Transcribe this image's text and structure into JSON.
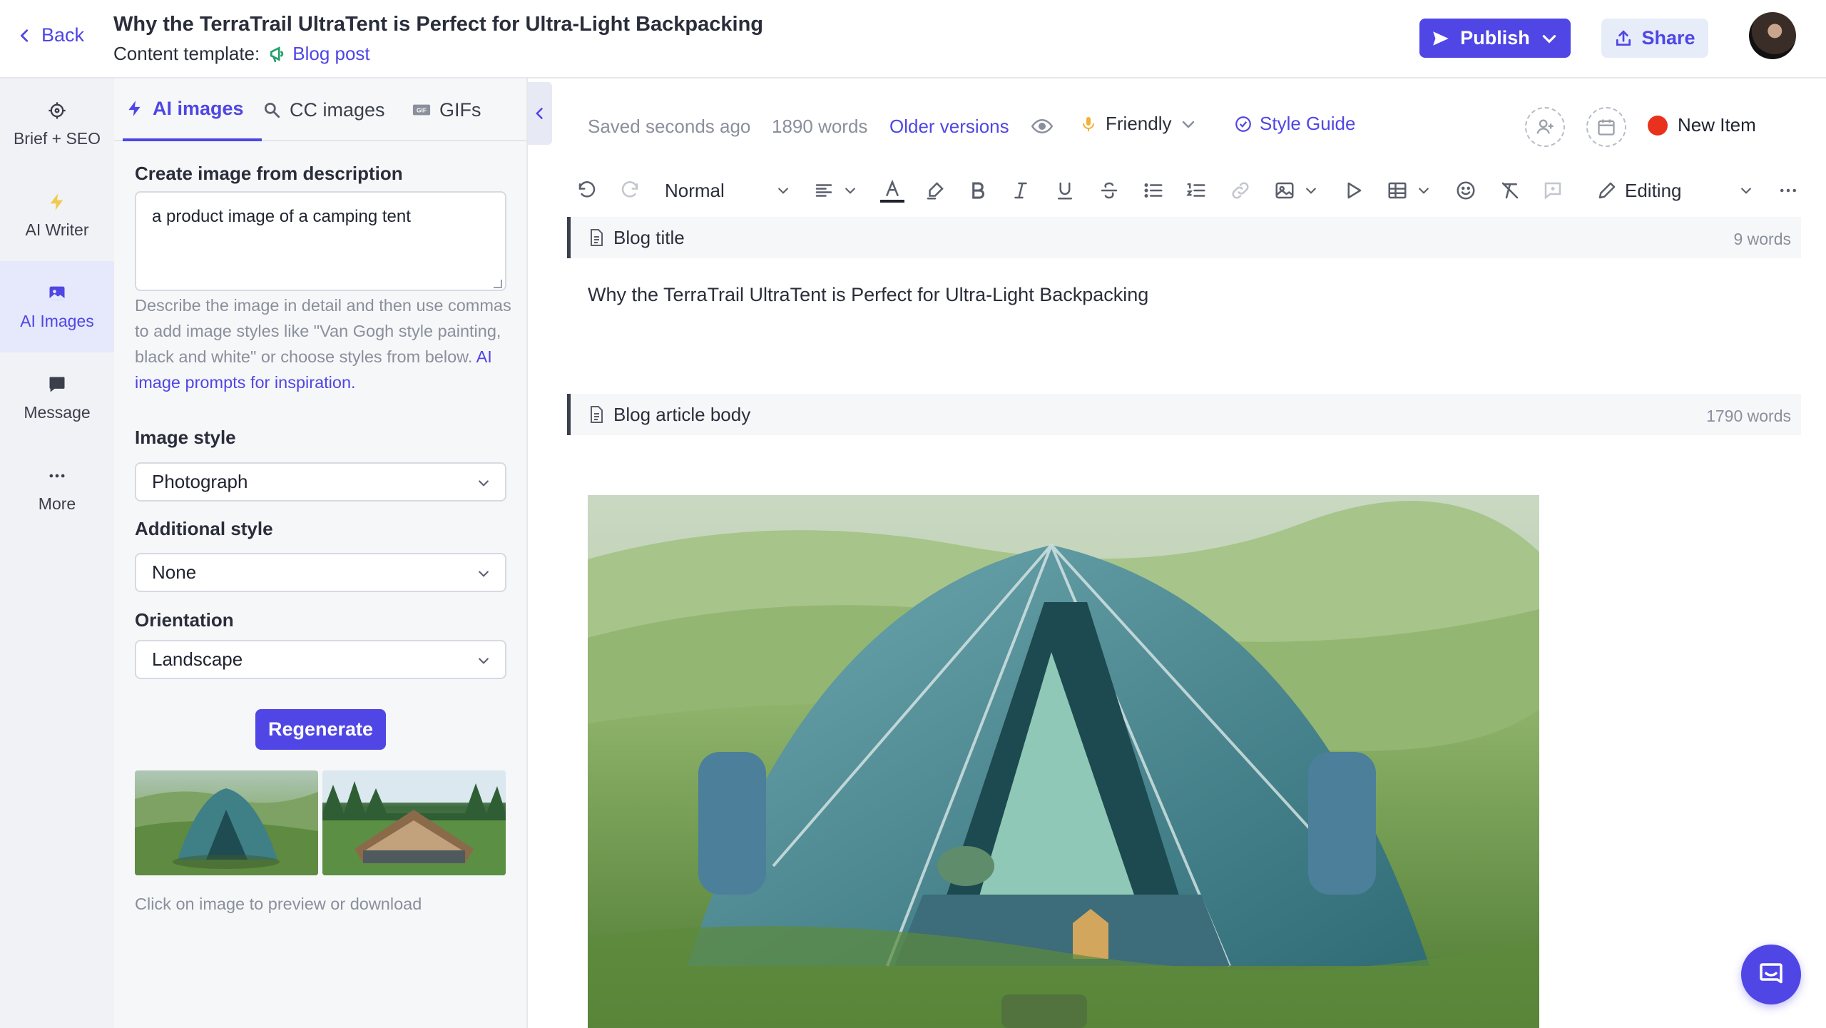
{
  "header": {
    "back_label": "Back",
    "title": "Why the TerraTrail UltraTent is Perfect for Ultra-Light Backpacking",
    "template_prefix": "Content template:",
    "template_name": "Blog post",
    "publish_label": "Publish",
    "share_label": "Share"
  },
  "rail": {
    "items": [
      {
        "label": "Brief + SEO",
        "icon": "crosshair-icon"
      },
      {
        "label": "AI Writer",
        "icon": "lightning-icon"
      },
      {
        "label": "AI Images",
        "icon": "image-icon"
      },
      {
        "label": "Message",
        "icon": "chat-icon"
      },
      {
        "label": "More",
        "icon": "ellipsis-icon"
      }
    ]
  },
  "panel": {
    "tabs": [
      {
        "label": "AI images",
        "icon": "lightning-icon"
      },
      {
        "label": "CC images",
        "icon": "search-icon"
      },
      {
        "label": "GIFs",
        "icon": "gif-icon"
      }
    ],
    "description_label": "Create image from description",
    "description_value": "a product image of a camping tent",
    "help_text": "Describe the image in detail and then use commas to add image styles like \"Van Gogh style painting, black and white\" or choose styles from below.",
    "help_link": "AI image prompts for inspiration.",
    "image_style_label": "Image style",
    "image_style_value": "Photograph",
    "additional_style_label": "Additional style",
    "additional_style_value": "None",
    "orientation_label": "Orientation",
    "orientation_value": "Landscape",
    "regenerate_label": "Regenerate",
    "thumbs_caption": "Click on image to preview or download"
  },
  "status": {
    "saved": "Saved seconds ago",
    "words": "1890 words",
    "older_versions": "Older versions",
    "tone": "Friendly",
    "style_guide": "Style Guide",
    "new_item": "New Item"
  },
  "toolbar": {
    "paragraph_style": "Normal",
    "mode": "Editing"
  },
  "editor": {
    "sections": [
      {
        "name": "Blog title",
        "count": "9 words"
      },
      {
        "name": "Blog article body",
        "count": "1790 words"
      }
    ],
    "blog_title_text": "Why the TerraTrail UltraTent is Perfect for Ultra-Light Backpacking"
  },
  "colors": {
    "accent": "#4f46e5",
    "new_item_dot": "#e8321e"
  }
}
